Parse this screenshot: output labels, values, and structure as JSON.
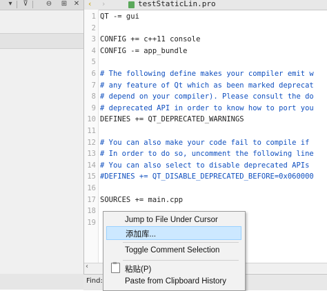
{
  "left_panel": {
    "toolbar_icons": [
      {
        "name": "chevron-down-icon",
        "glyph": "▾"
      },
      {
        "name": "filter-icon",
        "glyph": "⊽"
      },
      {
        "name": "link-icon",
        "glyph": "⊖"
      },
      {
        "name": "add-panel-icon",
        "glyph": "⊞"
      },
      {
        "name": "close-icon",
        "glyph": "✕"
      }
    ]
  },
  "editor": {
    "file_name": "testStaticLin.pro",
    "lines": [
      {
        "n": "1",
        "text": "QT -= gui",
        "type": "code"
      },
      {
        "n": "2",
        "text": "",
        "type": "code"
      },
      {
        "n": "3",
        "text": "CONFIG += c++11 console",
        "type": "code"
      },
      {
        "n": "4",
        "text": "CONFIG -= app_bundle",
        "type": "code"
      },
      {
        "n": "5",
        "text": "",
        "type": "code"
      },
      {
        "n": "6",
        "text": "# The following define makes your compiler emit w",
        "type": "comment"
      },
      {
        "n": "7",
        "text": "# any feature of Qt which as been marked deprecat",
        "type": "comment"
      },
      {
        "n": "8",
        "text": "# depend on your compiler). Please consult the do",
        "type": "comment"
      },
      {
        "n": "9",
        "text": "# deprecated API in order to know how to port you",
        "type": "comment"
      },
      {
        "n": "10",
        "text": "DEFINES += QT_DEPRECATED_WARNINGS",
        "type": "code"
      },
      {
        "n": "11",
        "text": "",
        "type": "code"
      },
      {
        "n": "12",
        "text": "# You can also make your code fail to compile if",
        "type": "comment"
      },
      {
        "n": "13",
        "text": "# In order to do so, uncomment the following line",
        "type": "comment"
      },
      {
        "n": "14",
        "text": "# You can also select to disable deprecated APIs",
        "type": "comment"
      },
      {
        "n": "15",
        "text": "#DEFINES += QT_DISABLE_DEPRECATED_BEFORE=0x060000",
        "type": "comment"
      },
      {
        "n": "16",
        "text": "",
        "type": "code"
      },
      {
        "n": "17",
        "text": "SOURCES += main.cpp",
        "type": "code"
      },
      {
        "n": "18",
        "text": "",
        "type": "code"
      },
      {
        "n": "19",
        "text": "",
        "type": "code"
      }
    ]
  },
  "find_bar": {
    "label": "Find:"
  },
  "context_menu": {
    "items": [
      {
        "label": "Jump to File Under Cursor",
        "highlighted": false
      },
      {
        "label": "添加库...",
        "highlighted": true
      },
      {
        "separator": true
      },
      {
        "label": "Toggle Comment Selection",
        "highlighted": false
      },
      {
        "separator": true
      },
      {
        "label": "粘贴(P)",
        "highlighted": false,
        "icon": "paste-icon"
      },
      {
        "label": "Paste from Clipboard History",
        "highlighted": false
      }
    ]
  },
  "colors": {
    "comment": "#0f4fbf",
    "highlight": "#cce8ff",
    "line_number": "#a7a7a7"
  }
}
